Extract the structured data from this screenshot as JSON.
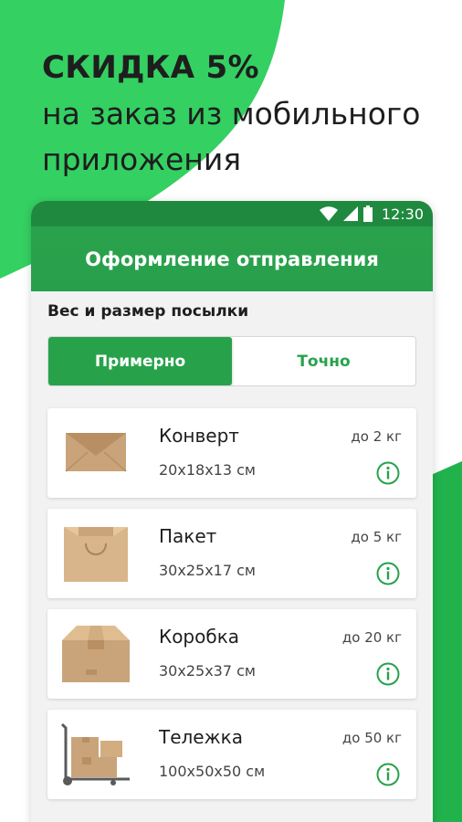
{
  "promo": {
    "title": "СКИДКА 5%",
    "line1": "на заказ из мобильного",
    "line2": "приложения"
  },
  "status_bar": {
    "time": "12:30",
    "icons": [
      "wifi-icon",
      "signal-icon",
      "battery-icon"
    ]
  },
  "app_bar": {
    "title": "Оформление отправления"
  },
  "section": {
    "label": "Вес и размер посылки"
  },
  "segmented": {
    "options": [
      {
        "label": "Примерно",
        "selected": true
      },
      {
        "label": "Точно",
        "selected": false
      }
    ]
  },
  "parcels": [
    {
      "name": "Конверт",
      "size": "20x18x13 см",
      "weight": "до 2 кг",
      "icon": "envelope-icon"
    },
    {
      "name": "Пакет",
      "size": "30x25x17 см",
      "weight": "до 5 кг",
      "icon": "bag-icon"
    },
    {
      "name": "Коробка",
      "size": "30x25x37 см",
      "weight": "до 20 кг",
      "icon": "box-icon"
    },
    {
      "name": "Тележка",
      "size": "100x50x50 см",
      "weight": "до 50 кг",
      "icon": "cart-icon"
    }
  ],
  "colors": {
    "brand_green": "#27a24b",
    "dark_green": "#1f8a3f",
    "background_green": "#2fcf5c",
    "cardboard": "#c9a47a"
  }
}
